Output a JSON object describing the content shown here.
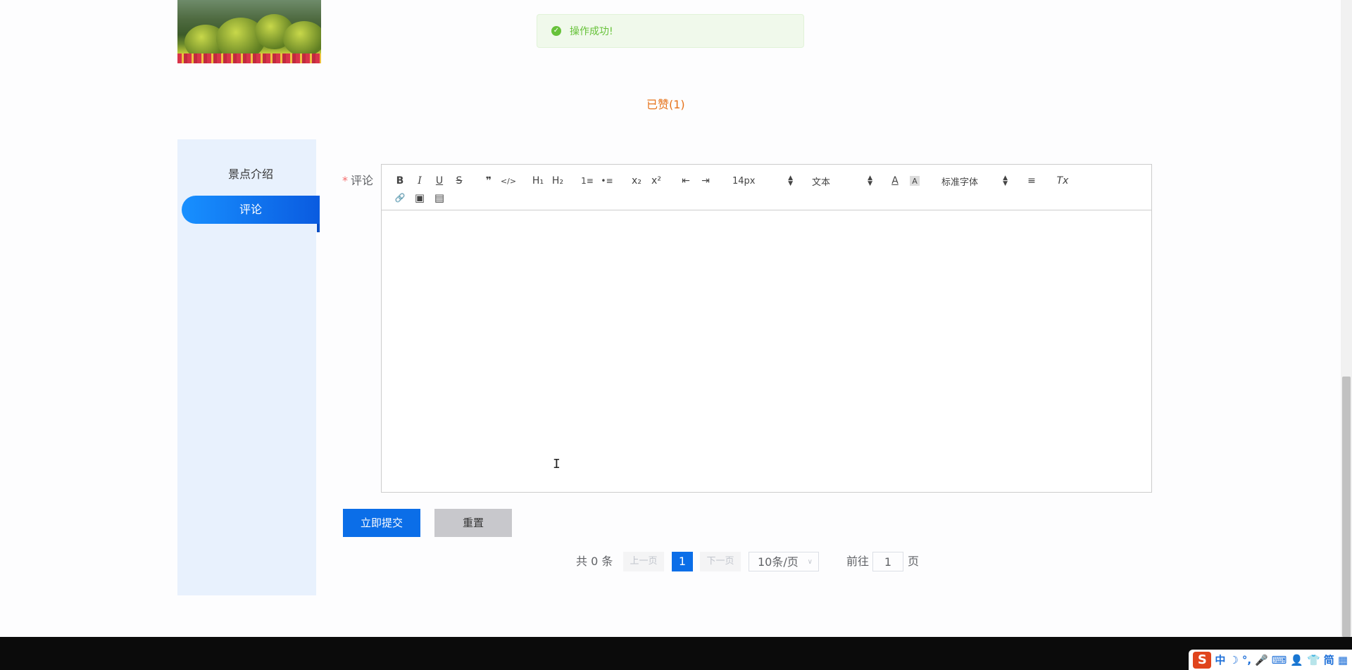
{
  "toast": {
    "message": "操作成功!",
    "icon": "check-circle-icon"
  },
  "like": {
    "label": "已赞(1)",
    "icon": "thumbs-up-icon"
  },
  "sidebar": {
    "items": [
      {
        "label": "景点介绍",
        "active": false
      },
      {
        "label": "评论",
        "active": true
      }
    ]
  },
  "form": {
    "required_mark": "*",
    "comment_label": "评论",
    "toolbar": {
      "bold": "B",
      "italic": "I",
      "underline": "U",
      "strike": "S",
      "blockquote": "❞",
      "code": "</>",
      "h1": "H₁",
      "h2": "H₂",
      "ordered_list": "1≡",
      "bullet_list": "•≡",
      "subscript": "x₂",
      "superscript": "x²",
      "outdent": "⇤",
      "indent": "⇥",
      "font_size": "14px",
      "text_type": "文本",
      "text_color": "A",
      "background_color": "A",
      "font_family": "标准字体",
      "align": "≡",
      "clean": "Tx",
      "link": "🔗",
      "image": "▣",
      "video": "▤"
    },
    "submit_label": "立即提交",
    "reset_label": "重置"
  },
  "pagination": {
    "total_text": "共 0 条",
    "prev_label": "上一页",
    "current_page": "1",
    "next_label": "下一页",
    "page_size": "10条/页",
    "goto_prefix": "前往",
    "goto_value": "1",
    "goto_suffix": "页"
  },
  "ime": {
    "logo": "S",
    "items": [
      "中",
      "☽",
      "°,",
      "🎤",
      "⌨",
      "👤",
      "👕",
      "简",
      "▦"
    ]
  },
  "colors": {
    "accent": "#0b6ee8",
    "success": "#67c23a",
    "like": "#e6721a",
    "sidebar_bg": "#e8f1fd"
  }
}
